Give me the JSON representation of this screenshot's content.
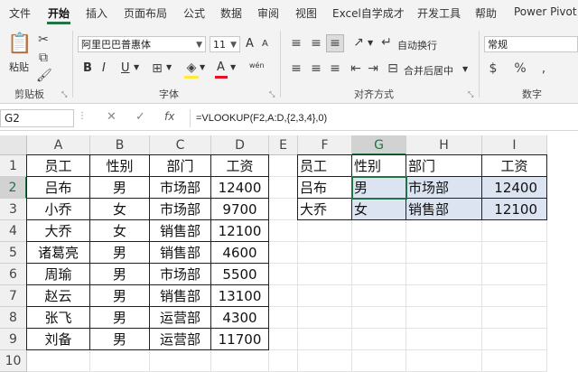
{
  "menu_tabs": [
    "文件",
    "开始",
    "插入",
    "页面布局",
    "公式",
    "数据",
    "审阅",
    "视图",
    "Excel自学成才",
    "开发工具",
    "帮助",
    "Power Pivot"
  ],
  "active_tab": "开始",
  "ribbon": {
    "paste_label": "粘贴",
    "clipboard_group": "剪贴板",
    "font_name": "阿里巴巴普惠体",
    "font_size": "11",
    "font_group": "字体",
    "bold": "B",
    "italic": "I",
    "underline": "U",
    "grow_font": "A",
    "shrink_font": "A",
    "font_color_glyph": "A",
    "phonetic_glyph": "wén",
    "wrap_text": "自动换行",
    "merge_center": "合并后居中",
    "alignment_group": "对齐方式",
    "number_format": "常规",
    "number_group": "数字",
    "accent_color": "#217346"
  },
  "formula_bar": {
    "name_box": "G2",
    "fx": "fx",
    "formula": "=VLOOKUP(F2,A:D,{2,3,4},0)"
  },
  "sheet": {
    "columns": [
      "A",
      "B",
      "C",
      "D",
      "E",
      "F",
      "G",
      "H",
      "I"
    ],
    "selected_column": "G",
    "rows": [
      "1",
      "2",
      "3",
      "4",
      "5",
      "6",
      "7",
      "8",
      "9",
      "10"
    ],
    "selected_row": "2",
    "left_table": {
      "headers": [
        "员工",
        "性别",
        "部门",
        "工资"
      ],
      "records": [
        [
          "吕布",
          "男",
          "市场部",
          "12400"
        ],
        [
          "小乔",
          "女",
          "市场部",
          "9700"
        ],
        [
          "大乔",
          "女",
          "销售部",
          "12100"
        ],
        [
          "诸葛亮",
          "男",
          "销售部",
          "4600"
        ],
        [
          "周瑜",
          "男",
          "市场部",
          "5500"
        ],
        [
          "赵云",
          "男",
          "销售部",
          "13100"
        ],
        [
          "张飞",
          "男",
          "运营部",
          "4300"
        ],
        [
          "刘备",
          "男",
          "运营部",
          "11700"
        ]
      ]
    },
    "right_table": {
      "headers": [
        "员工",
        "性别",
        "部门",
        "工资"
      ],
      "records": [
        [
          "吕布",
          "男",
          "市场部",
          "12400"
        ],
        [
          "大乔",
          "女",
          "销售部",
          "12100"
        ]
      ]
    }
  }
}
